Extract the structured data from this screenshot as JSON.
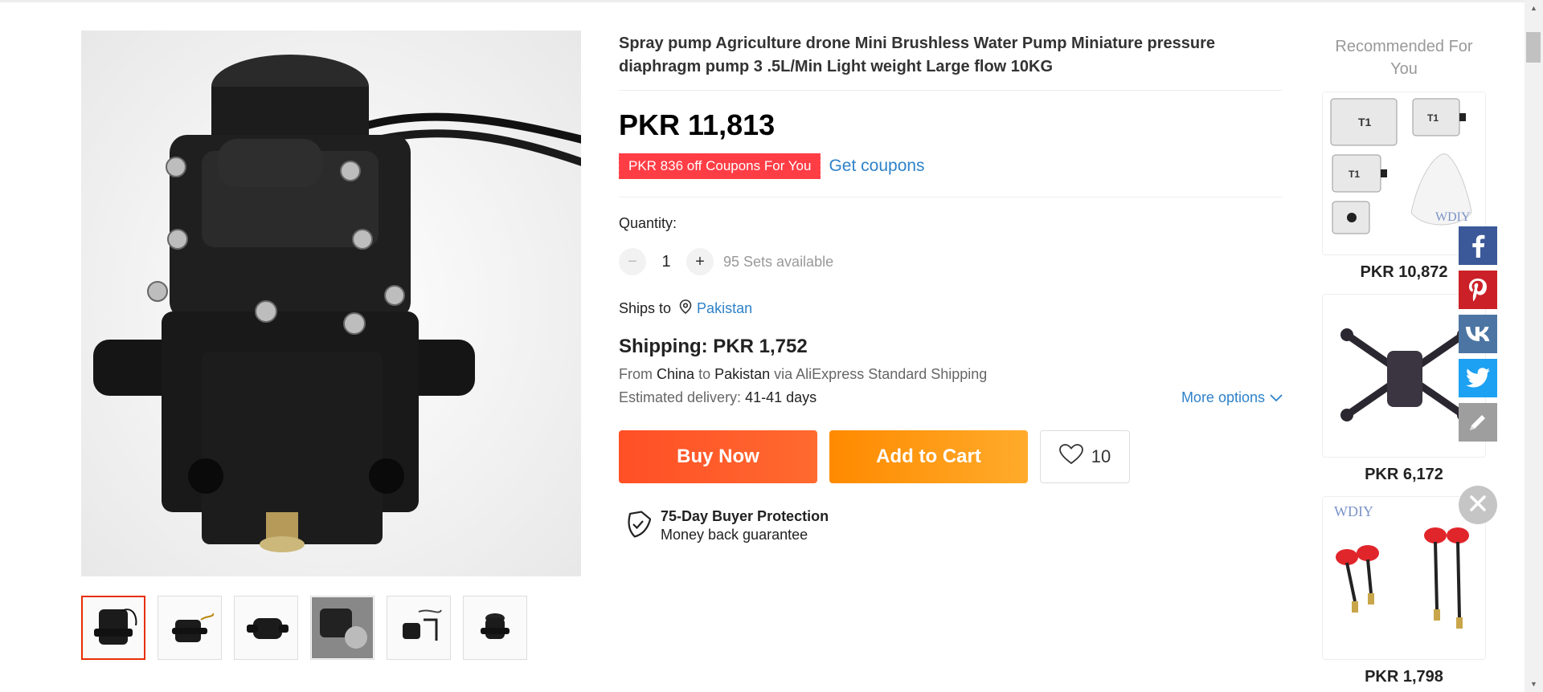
{
  "product": {
    "title": "Spray pump Agriculture drone Mini Brushless Water Pump Miniature pressure diaphragm pump 3 .5L/Min Light weight Large flow 10KG",
    "price": "PKR 11,813",
    "coupon_tag": "PKR 836 off Coupons For You",
    "coupon_link": "Get coupons",
    "quantity_label": "Quantity:",
    "quantity_value": "1",
    "stepper_minus": "−",
    "stepper_plus": "+",
    "available": "95 Sets available",
    "ships_to_label": "Ships to",
    "ships_to_country": "Pakistan",
    "shipping_cost": "Shipping: PKR 1,752",
    "from_word": "From",
    "from_country": "China",
    "to_word": "to",
    "to_country": "Pakistan",
    "via_text": "via AliExpress Standard Shipping",
    "estimated_label": "Estimated delivery:",
    "estimated_value": "41-41 days",
    "more_options": "More options",
    "buy_now": "Buy Now",
    "add_to_cart": "Add to Cart",
    "wishlist_count": "10",
    "protection_title": "75-Day Buyer Protection",
    "protection_sub": "Money back guarantee"
  },
  "gallery": {
    "thumbnail_count": 6,
    "active_index": 0
  },
  "recommended": {
    "title": "Recommended For You",
    "items": [
      {
        "price": "PKR 10,872",
        "watermark": "WDIY"
      },
      {
        "price": "PKR 6,172"
      },
      {
        "price": "PKR 1,798",
        "watermark": "WDIY"
      }
    ]
  },
  "share": [
    "facebook-icon",
    "pinterest-icon",
    "vk-icon",
    "twitter-icon",
    "edit-icon"
  ],
  "colors": {
    "price_text": "#000000",
    "coupon_bg": "#ff3d45",
    "link": "#2e82c9",
    "buy_now": "#ff5a2a",
    "add_to_cart": "#ff9a15",
    "facebook": "#3b5998",
    "pinterest": "#cb2027",
    "vk": "#4c75a3",
    "twitter": "#1da1f2"
  }
}
